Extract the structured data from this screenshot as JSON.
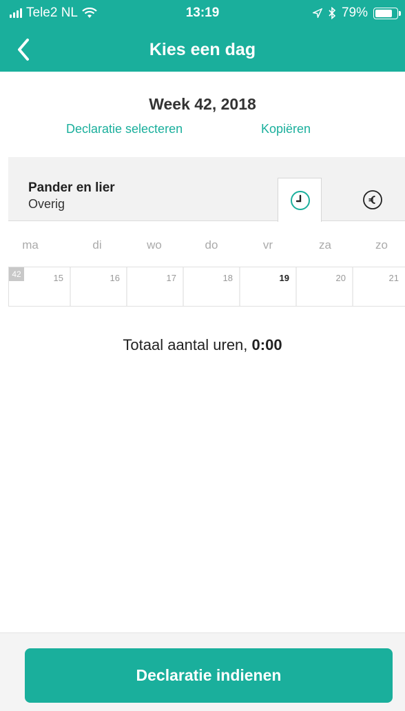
{
  "status_bar": {
    "carrier": "Tele2 NL",
    "time": "13:19",
    "battery": "79%"
  },
  "nav": {
    "title": "Kies een dag"
  },
  "week": {
    "title": "Week 42, 2018",
    "select_label": "Declaratie selecteren",
    "copy_label": "Kopiëren"
  },
  "project": {
    "name": "Pander en lier",
    "category": "Overig"
  },
  "days": {
    "labels": [
      "ma",
      "di",
      "wo",
      "do",
      "vr",
      "za",
      "zo"
    ],
    "week_number": "42",
    "dates": [
      "15",
      "16",
      "17",
      "18",
      "19",
      "20",
      "21"
    ],
    "today_index": 4
  },
  "total": {
    "label": "Totaal aantal uren,",
    "value": "0:00"
  },
  "bottom": {
    "submit_label": "Declaratie indienen"
  },
  "colors": {
    "accent": "#1aaf9c"
  }
}
